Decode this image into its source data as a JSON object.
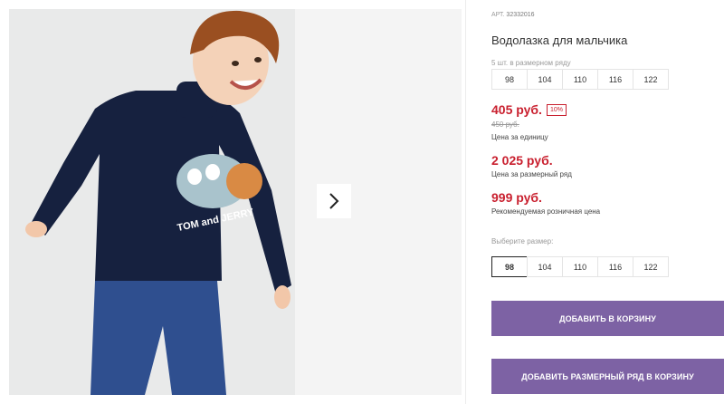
{
  "product": {
    "article_label": "АРТ.",
    "article": "32332016",
    "title": "Водолазка для мальчика",
    "pack_note": "5 шт. в размерном ряду",
    "pack_sizes": [
      "98",
      "104",
      "110",
      "116",
      "122"
    ],
    "price": "405 руб.",
    "discount": "10%",
    "old_price": "450 руб.",
    "unit_price_label": "Цена за единицу",
    "row_price": "2 025 руб.",
    "row_price_label": "Цена за размерный ряд",
    "retail_price": "999 руб.",
    "retail_price_label": "Рекомендуемая розничная цена",
    "choose_size_label": "Выберите размер:",
    "select_sizes": [
      "98",
      "104",
      "110",
      "116",
      "122"
    ],
    "selected_size": "98",
    "add_to_cart": "ДОБАВИТЬ В КОРЗИНУ",
    "add_row_to_cart": "ДОБАВИТЬ РАЗМЕРНЫЙ РЯД В КОРЗИНУ"
  },
  "gallery": {
    "next_icon": "chevron-right-icon",
    "print_text": "TOM and JERRY"
  },
  "colors": {
    "price_red": "#c9202f",
    "button_purple": "#7d62a4",
    "shirt_navy": "#16213f"
  }
}
